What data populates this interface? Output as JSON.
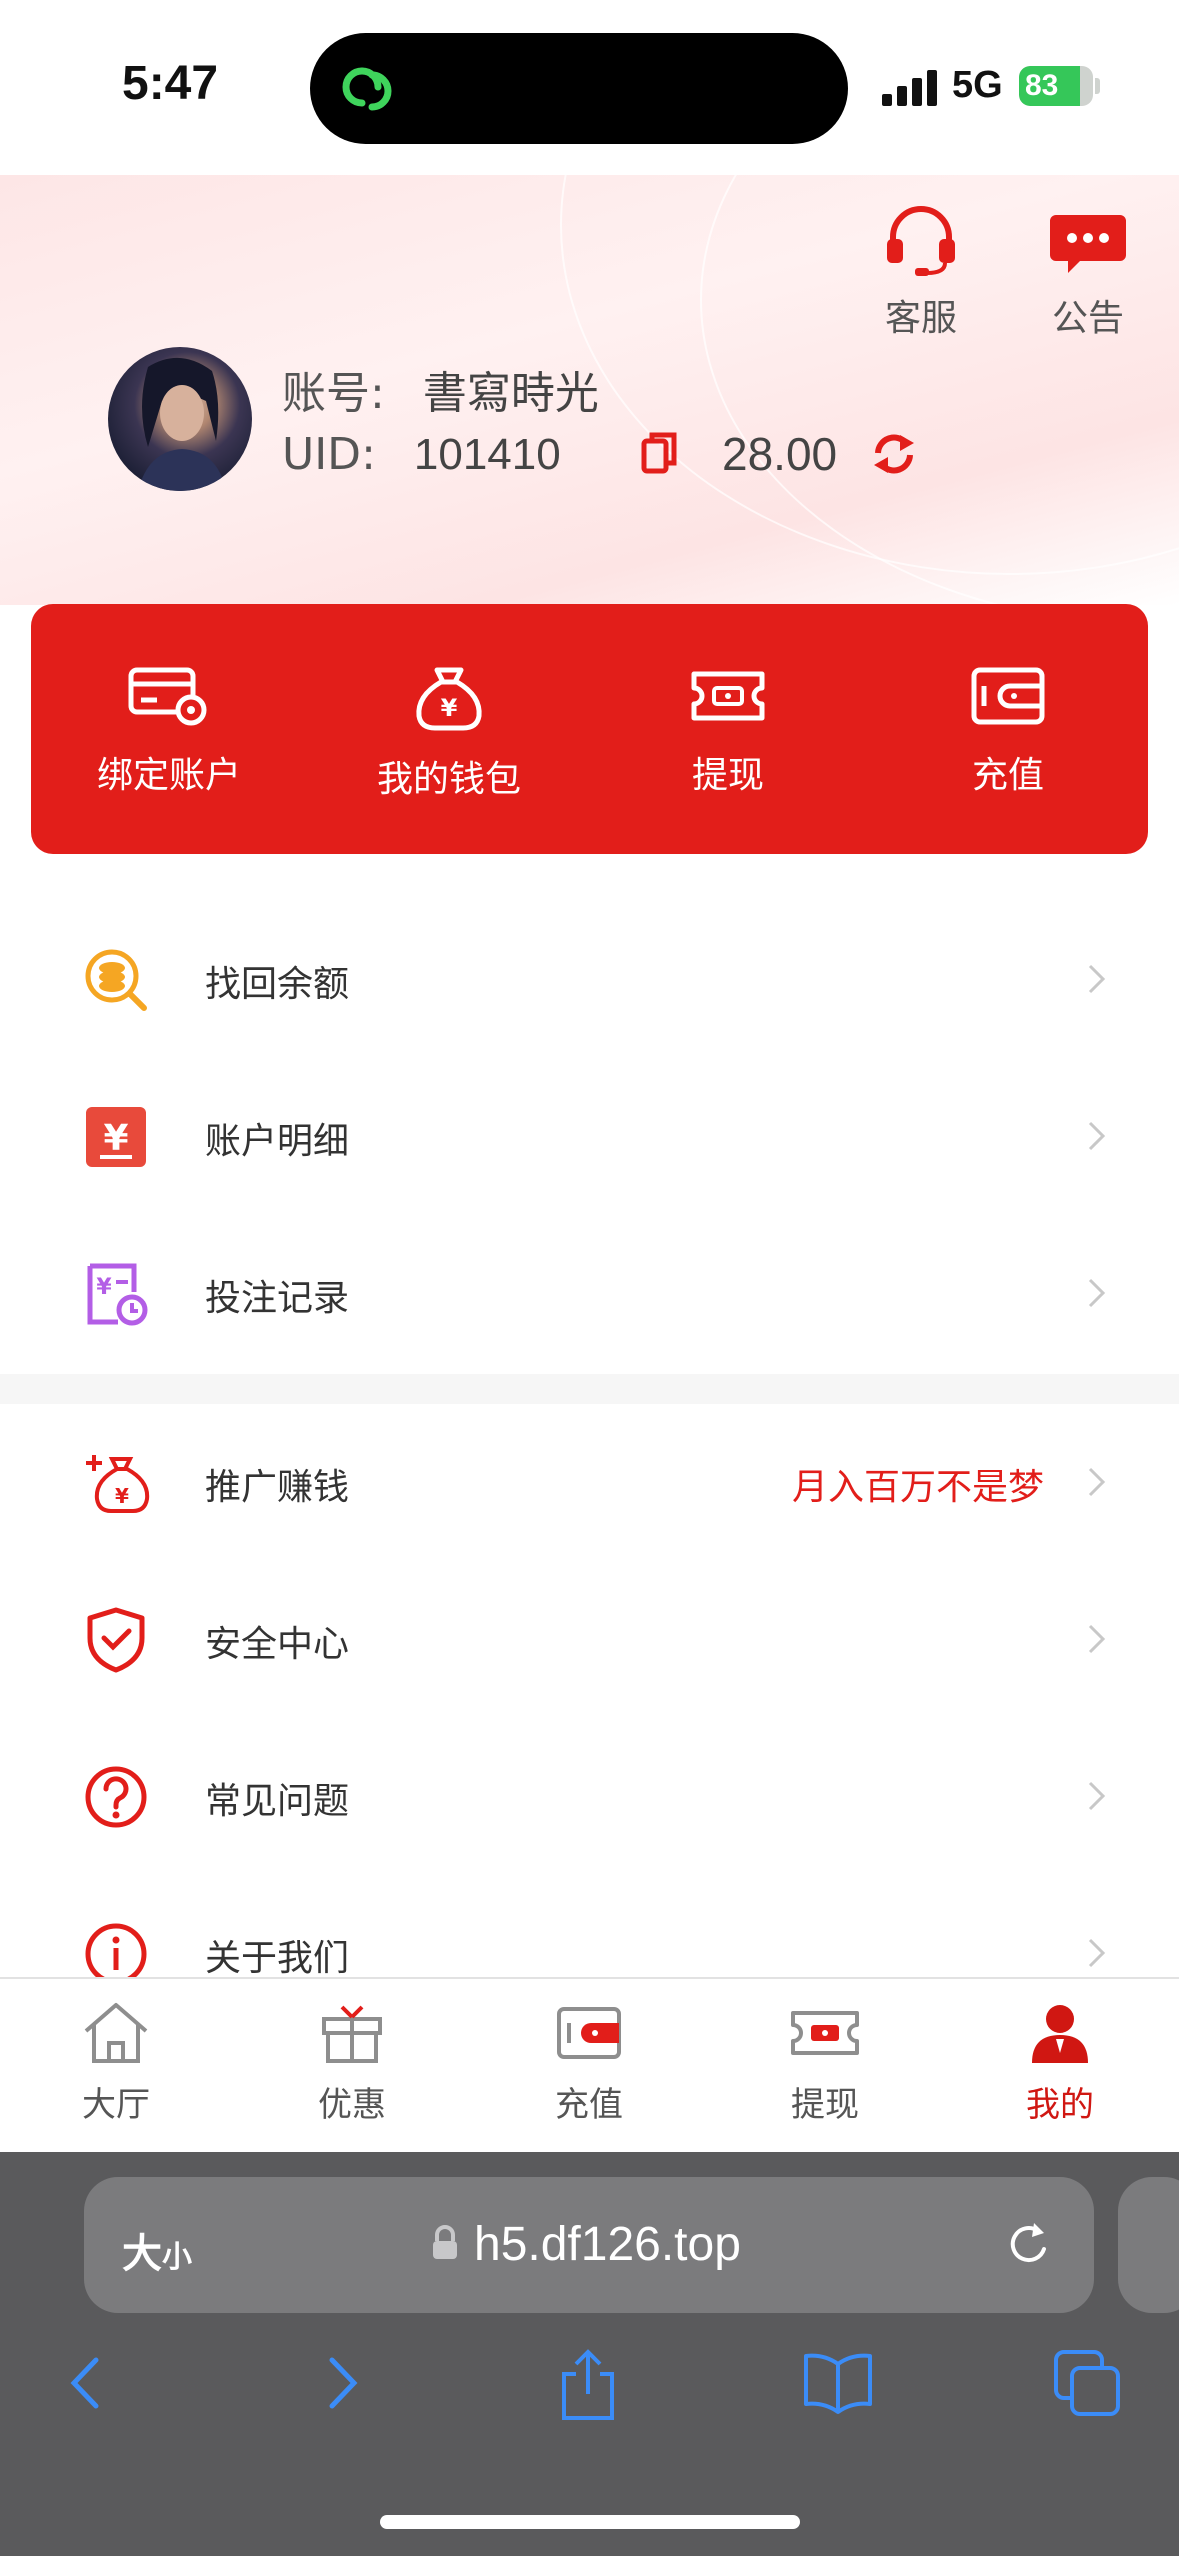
{
  "status_bar": {
    "time": "5:47",
    "network": "5G",
    "battery": 83
  },
  "header": {
    "actions": [
      {
        "label": "客服",
        "icon": "headset-icon"
      },
      {
        "label": "公告",
        "icon": "chat-bubble-icon"
      }
    ],
    "account_label": "账号:",
    "account_name": "書寫時光",
    "uid_label": "UID:",
    "uid": "101410",
    "balance": "28.00"
  },
  "quick_actions": [
    {
      "label": "绑定账户",
      "icon": "bank-card-gear-icon"
    },
    {
      "label": "我的钱包",
      "icon": "money-bag-icon"
    },
    {
      "label": "提现",
      "icon": "withdraw-ticket-icon"
    },
    {
      "label": "充值",
      "icon": "wallet-icon"
    }
  ],
  "menu_group_1": [
    {
      "label": "找回余额",
      "icon": "coin-search-icon"
    },
    {
      "label": "账户明细",
      "icon": "ledger-yen-icon"
    },
    {
      "label": "投注记录",
      "icon": "bet-record-icon"
    }
  ],
  "menu_group_2": [
    {
      "label": "推广赚钱",
      "icon": "money-bag-plus-icon",
      "promo": "月入百万不是梦"
    },
    {
      "label": "安全中心",
      "icon": "shield-check-icon"
    },
    {
      "label": "常见问题",
      "icon": "question-circle-icon"
    },
    {
      "label": "关于我们",
      "icon": "info-circle-icon"
    }
  ],
  "tab_bar": [
    {
      "label": "大厅",
      "icon": "home-icon"
    },
    {
      "label": "优惠",
      "icon": "gift-icon"
    },
    {
      "label": "充值",
      "icon": "wallet-icon"
    },
    {
      "label": "提现",
      "icon": "withdraw-ticket-icon"
    },
    {
      "label": "我的",
      "icon": "user-icon",
      "active": true
    }
  ],
  "browser": {
    "text_size_big": "大",
    "text_size_small": "小",
    "url": "h5.df126.top"
  },
  "colors": {
    "brand_red": "#e21e1a",
    "active_tab": "#d01712",
    "browser_bar": "#5a5a5c",
    "battery_green": "#35c759"
  }
}
